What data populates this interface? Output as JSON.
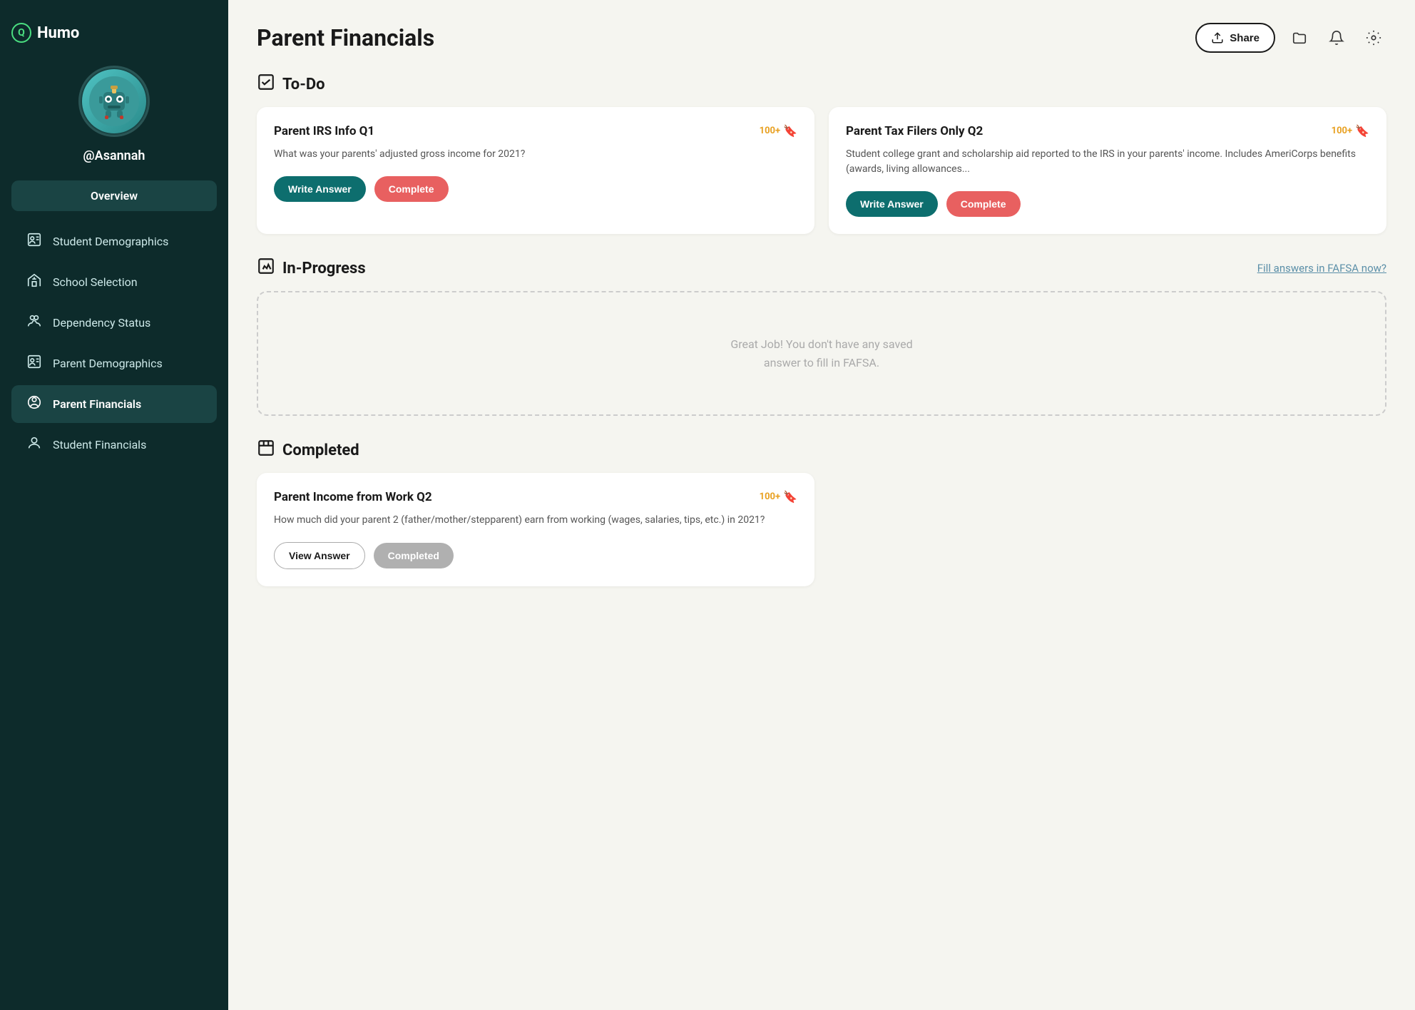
{
  "app": {
    "logo_letter": "Q",
    "logo_name": "Humo"
  },
  "sidebar": {
    "username": "@Asannah",
    "overview_label": "Overview",
    "nav_items": [
      {
        "id": "student-demographics",
        "label": "Student Demographics",
        "icon": "👤"
      },
      {
        "id": "school-selection",
        "label": "School Selection",
        "icon": "🏫"
      },
      {
        "id": "dependency-status",
        "label": "Dependency Status",
        "icon": "👥"
      },
      {
        "id": "parent-demographics",
        "label": "Parent Demographics",
        "icon": "👤"
      },
      {
        "id": "parent-financials",
        "label": "Parent Financials",
        "icon": "💰"
      },
      {
        "id": "student-financials",
        "label": "Student Financials",
        "icon": "💵"
      }
    ]
  },
  "main": {
    "page_title": "Parent Financials",
    "share_label": "Share",
    "sections": {
      "todo": {
        "icon": "☑",
        "title": "To-Do",
        "cards": [
          {
            "id": "card-1",
            "title": "Parent IRS Info Q1",
            "badge": "100+",
            "description": "What was your parents' adjusted gross income for 2021?",
            "write_label": "Write Answer",
            "complete_label": "Complete"
          },
          {
            "id": "card-2",
            "title": "Parent Tax Filers Only Q2",
            "badge": "100+",
            "description": "Student college grant and scholarship aid reported to the IRS in your parents' income. Includes AmeriCorps benefits (awards, living allowances...",
            "write_label": "Write Answer",
            "complete_label": "Complete"
          }
        ]
      },
      "in_progress": {
        "icon": "✏",
        "title": "In-Progress",
        "fill_link": "Fill answers in FAFSA now?",
        "empty_message": "Great Job! You don't have any saved\nanswer to fill in FAFSA."
      },
      "completed": {
        "icon": "📋",
        "title": "Completed",
        "cards": [
          {
            "id": "card-completed-1",
            "title": "Parent Income from Work Q2",
            "badge": "100+",
            "description": "How much did your parent 2 (father/mother/stepparent) earn from working (wages, salaries, tips, etc.) in 2021?",
            "view_label": "View Answer",
            "completed_label": "Completed"
          }
        ]
      }
    }
  }
}
